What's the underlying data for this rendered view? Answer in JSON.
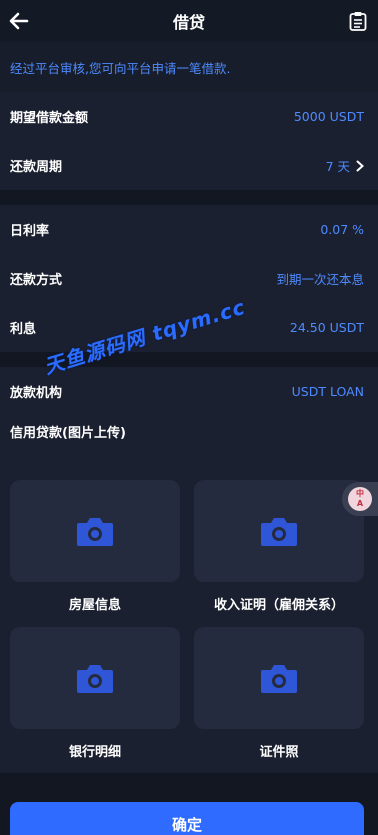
{
  "header": {
    "title": "借贷",
    "back_icon": "arrow-left-icon",
    "right_icon": "clipboard-icon"
  },
  "notice": "经过平台审核,您可向平台申请一笔借款.",
  "loan": {
    "amount_label": "期望借款金额",
    "amount_value": "5000 USDT",
    "period_label": "还款周期",
    "period_value": "7 天"
  },
  "terms": {
    "rate_label": "日利率",
    "rate_value": "0.07 %",
    "method_label": "还款方式",
    "method_value": "到期一次还本息",
    "interest_label": "利息",
    "interest_value": "24.50 USDT"
  },
  "institution": {
    "label": "放款机构",
    "value": "USDT LOAN"
  },
  "upload": {
    "title": "信用贷款(图片上传)",
    "items": [
      {
        "label": "房屋信息",
        "icon": "camera-icon"
      },
      {
        "label": "收入证明（雇佣关系）",
        "icon": "camera-icon"
      },
      {
        "label": "银行明细",
        "icon": "camera-icon"
      },
      {
        "label": "证件照",
        "icon": "camera-icon"
      }
    ]
  },
  "translate_badge": {
    "line1": "中",
    "line2": "A"
  },
  "watermark": "天鱼源码网 tqym.cc",
  "confirm_label": "确定",
  "colors": {
    "background": "#121722",
    "panel": "#1b2030",
    "tile": "#252b3e",
    "accent": "#4d8bff",
    "button": "#2f6bff",
    "camera": "#2f56d6"
  }
}
